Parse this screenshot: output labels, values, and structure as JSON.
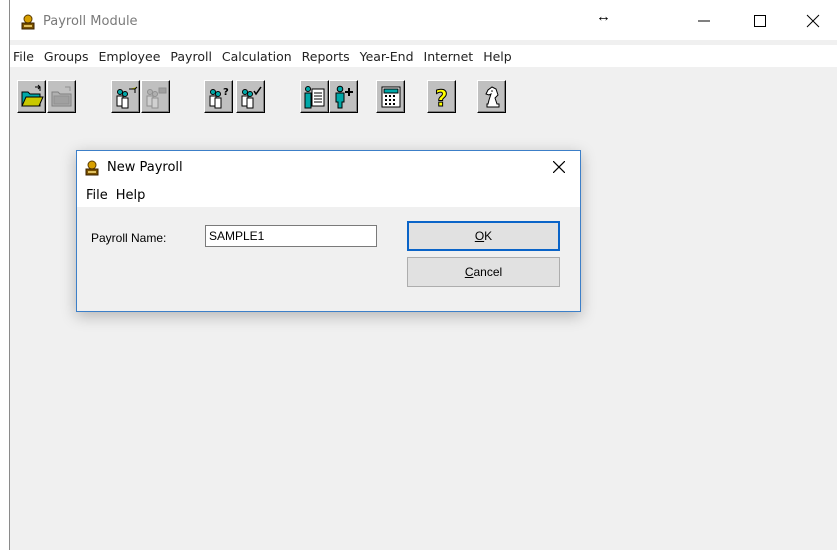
{
  "window": {
    "title": "Payroll Module",
    "resize_cursor": "↔"
  },
  "menubar": {
    "items": [
      {
        "label": "File"
      },
      {
        "label": "Groups"
      },
      {
        "label": "Employee"
      },
      {
        "label": "Payroll"
      },
      {
        "label": "Calculation"
      },
      {
        "label": "Reports"
      },
      {
        "label": "Year-End"
      },
      {
        "label": "Internet"
      },
      {
        "label": "Help"
      }
    ]
  },
  "toolbar": {
    "buttons": [
      {
        "name": "open-folder-icon",
        "enabled": true
      },
      {
        "name": "close-folder-icon",
        "enabled": false
      },
      {
        "name": "open-group-icon",
        "enabled": true
      },
      {
        "name": "close-group-icon",
        "enabled": false
      },
      {
        "name": "group-query-icon",
        "enabled": true
      },
      {
        "name": "group-check-icon",
        "enabled": true
      },
      {
        "name": "employee-file-icon",
        "enabled": true
      },
      {
        "name": "add-employee-icon",
        "enabled": true
      },
      {
        "name": "calculator-icon",
        "enabled": true
      },
      {
        "name": "help-question-icon",
        "enabled": true
      },
      {
        "name": "knight-chess-icon",
        "enabled": true
      }
    ]
  },
  "dialog": {
    "title": "New Payroll",
    "menu": [
      {
        "label": "File"
      },
      {
        "label": "Help"
      }
    ],
    "field_label": "Payroll Name:",
    "field_value": "SAMPLE1",
    "ok_key": "O",
    "ok_rest": "K",
    "cancel_key": "C",
    "cancel_rest": "ancel"
  },
  "colors": {
    "dialog_border": "#3c7fc8",
    "default_button_border": "#0a64c8",
    "toolbar_face": "#c0c0c0",
    "icon_teal": "#00a8a8"
  }
}
